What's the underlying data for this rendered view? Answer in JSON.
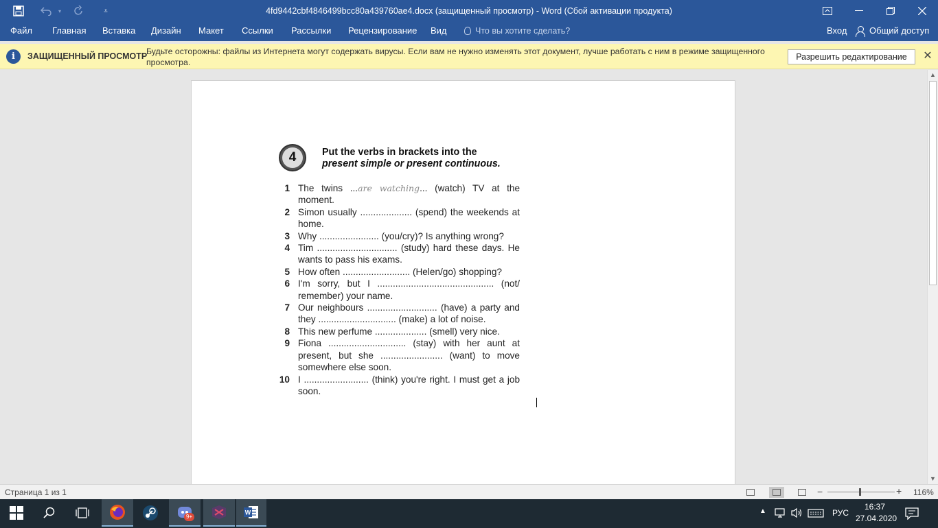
{
  "titlebar": {
    "title": "4fd9442cbf4846499bcc80a439760ae4.docx (защищенный просмотр) - Word (Сбой активации продукта)",
    "save_icon": "save-icon",
    "undo_icon": "undo-icon",
    "redo_icon": "redo-icon",
    "customize_icon": "customize-qat-icon"
  },
  "ribbon": {
    "tabs": [
      "Файл",
      "Главная",
      "Вставка",
      "Дизайн",
      "Макет",
      "Ссылки",
      "Рассылки",
      "Рецензирование",
      "Вид"
    ],
    "tell_me": "Что вы хотите сделать?",
    "sign_in": "Вход",
    "share": "Общий доступ"
  },
  "protected_view": {
    "title": "ЗАЩИЩЕННЫЙ ПРОСМОТР",
    "message": "Будьте осторожны: файлы из Интернета могут содержать вирусы. Если вам не нужно изменять этот документ, лучше работать с ним в режиме защищенного просмотра.",
    "enable_button": "Разрешить редактирование"
  },
  "exercise": {
    "number": "4",
    "heading_line1": "Put the verbs in brackets into the",
    "heading_line2": "present simple or present continuous.",
    "items": [
      {
        "num": "1",
        "before": "The twins ...",
        "answer": "are watching",
        "after": "... (watch) TV at the moment."
      },
      {
        "num": "2",
        "text": "Simon usually .................... (spend) the weekends at home."
      },
      {
        "num": "3",
        "text": "Why ....................... (you/cry)? Is anything wrong?"
      },
      {
        "num": "4",
        "text": "Tim ............................... (study) hard these days. He wants to pass his exams."
      },
      {
        "num": "5",
        "text": "How often .......................... (Helen/go) shopping?"
      },
      {
        "num": "6",
        "text": "I'm sorry, but I ............................................. (not/ remember) your name."
      },
      {
        "num": "7",
        "text": "Our neighbours ........................... (have) a party and they .............................. (make) a lot of noise."
      },
      {
        "num": "8",
        "text": "This new perfume .................... (smell) very nice."
      },
      {
        "num": "9",
        "text": "Fiona .............................. (stay) with her aunt at present, but she ........................ (want) to move somewhere else soon."
      },
      {
        "num": "10",
        "text": "I ......................... (think) you're right. I must get a job soon."
      }
    ]
  },
  "statusbar": {
    "page": "Страница 1 из 1",
    "zoom": "116%",
    "zoom_level": 0.47
  },
  "taskbar": {
    "lang": "РУС",
    "time": "16:37",
    "date": "27.04.2020",
    "notification_badge": "9+"
  },
  "colors": {
    "word_blue": "#2b579a",
    "protected_bar": "#fdf6b2",
    "taskbar": "#1e2a33"
  }
}
